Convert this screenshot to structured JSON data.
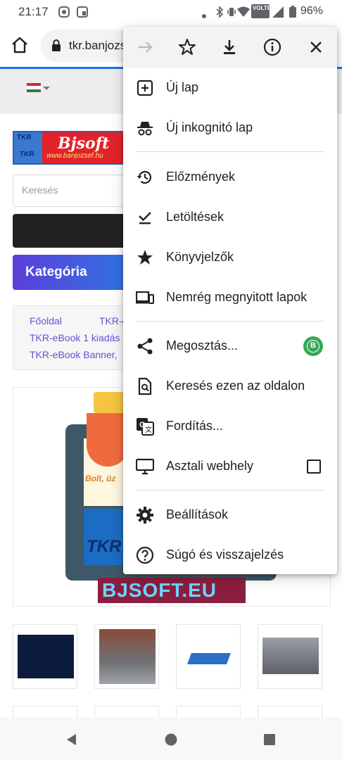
{
  "status_bar": {
    "time": "21:17",
    "battery_percent": "96%",
    "network_label": "VOLTE"
  },
  "toolbar": {
    "url": "tkr.banjozsef.hu"
  },
  "page": {
    "logo_title": "Bjsoft",
    "logo_url": "www.banjozsef.hu",
    "logo_badge": "TKR",
    "search_placeholder": "Keresés",
    "category_button": "Kategória",
    "breadcrumbs": [
      "Főoldal",
      "TKR-e",
      "TKR-eBook 1 kiadás",
      "TKR-eBook Banner,"
    ],
    "product_caption": "Bolt, üz",
    "product_banner": "BJSOFT.EU",
    "product_tkr": "TKR"
  },
  "menu": {
    "items": [
      {
        "label": "Új lap",
        "icon": "new-tab-icon"
      },
      {
        "label": "Új inkognitó lap",
        "icon": "incognito-icon"
      },
      {
        "label": "Előzmények",
        "icon": "history-icon"
      },
      {
        "label": "Letöltések",
        "icon": "downloads-icon"
      },
      {
        "label": "Könyvjelzők",
        "icon": "bookmarks-star-icon"
      },
      {
        "label": "Nemrég megnyitott lapok",
        "icon": "recent-tabs-icon"
      },
      {
        "label": "Megosztás...",
        "icon": "share-icon"
      },
      {
        "label": "Keresés ezen az oldalon",
        "icon": "find-in-page-icon"
      },
      {
        "label": "Fordítás...",
        "icon": "translate-icon"
      },
      {
        "label": "Asztali webhely",
        "icon": "desktop-icon"
      },
      {
        "label": "Beállítások",
        "icon": "settings-gear-icon"
      },
      {
        "label": "Súgó és visszajelzés",
        "icon": "help-icon"
      }
    ],
    "share_badge_letter": "B",
    "desktop_site_checked": false
  },
  "colors": {
    "accent_blue": "#1a73e8",
    "menu_header_bg": "#f1f3f4",
    "whatsapp_green": "#34a853",
    "category_gradient": [
      "#5b3fd9",
      "#2f74e3"
    ],
    "logo_red": "#e3222a"
  }
}
